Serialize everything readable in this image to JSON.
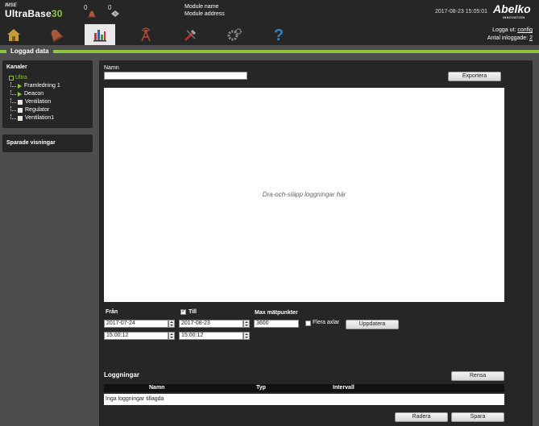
{
  "header": {
    "brand_small": "IMSE",
    "brand_main": "UltraBase",
    "brand_num": "30",
    "alarm_count_1": "0",
    "alarm_count_2": "0",
    "module_name": "Module name",
    "module_address": "Module address",
    "datetime": "2017-08-23 15:05:01",
    "logo": "Abelko",
    "logo_sub": "INNOVATION"
  },
  "nav": {
    "items": [
      {
        "icon": "home-icon"
      },
      {
        "icon": "bell-icon"
      },
      {
        "icon": "chart-icon",
        "active": true
      },
      {
        "icon": "antenna-icon"
      },
      {
        "icon": "tools-icon"
      },
      {
        "icon": "gear-icon"
      },
      {
        "icon": "help-icon"
      }
    ],
    "logout_label": "Logga ut:",
    "logout_user": "config",
    "logged_in_label": "Antal inloggade:",
    "logged_in_count": "2"
  },
  "section_title": "Loggad data",
  "channels": {
    "title": "Kanaler",
    "root": "Ultra",
    "items": [
      {
        "label": "Framledning 1",
        "type": "arrow"
      },
      {
        "label": "Deacon",
        "type": "arrow"
      },
      {
        "label": "Ventilation",
        "type": "box"
      },
      {
        "label": "Regulator",
        "type": "box"
      },
      {
        "label": "Ventilation1",
        "type": "box"
      }
    ]
  },
  "saved_views": {
    "title": "Sparade visningar"
  },
  "main": {
    "name_label": "Namn",
    "name_value": "",
    "export_label": "Exportera",
    "drop_text": "Dra-och-släpp loggningar här",
    "from_label": "Från",
    "from_date": "2017-07-24",
    "from_time": "15:00:12",
    "to_label": "Till",
    "to_checked": true,
    "to_date": "2017-08-23",
    "to_time": "15:00:12",
    "max_points_label": "Max mätpunkter",
    "max_points_value": "3600",
    "multi_axes_label": "Flera axlar",
    "multi_axes_checked": false,
    "update_label": "Uppdatera",
    "loggings_title": "Loggningar",
    "clear_label": "Rensa",
    "columns": [
      "Namn",
      "Typ",
      "Intervall"
    ],
    "empty_text": "Inga loggningar tillagda",
    "delete_label": "Radera",
    "save_label": "Spara"
  },
  "colors": {
    "accent": "#8cc63f",
    "panel": "#262626",
    "background": "#4d4d4d"
  }
}
